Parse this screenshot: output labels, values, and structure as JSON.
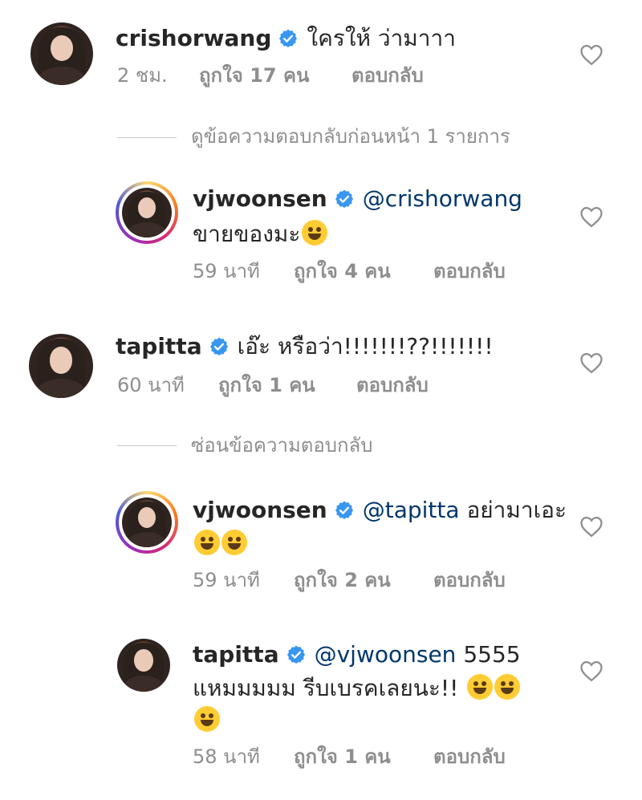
{
  "comments": [
    {
      "username": "crishorwang",
      "mention": "",
      "text": "ใครให้ ว่ามาาา",
      "text2": "",
      "time": "2 ชม.",
      "likes": "ถูกใจ 17 คน",
      "reply": "ตอบกลับ"
    },
    {
      "username": "vjwoonsen",
      "mention": "@crishorwang",
      "text": "",
      "text2": "ขายของมะ",
      "time": "59 นาที",
      "likes": "ถูกใจ 4 คน",
      "reply": "ตอบกลับ"
    },
    {
      "username": "tapitta",
      "mention": "",
      "text": "เอ๊ะ หรือว่า!!!!!!!??!!!!!!!",
      "text2": "",
      "time": "60 นาที",
      "likes": "ถูกใจ 1 คน",
      "reply": "ตอบกลับ"
    },
    {
      "username": "vjwoonsen",
      "mention": "@tapitta",
      "text": "อย่ามาเอะ",
      "text2": "",
      "time": "59 นาที",
      "likes": "ถูกใจ 2 คน",
      "reply": "ตอบกลับ"
    },
    {
      "username": "tapitta",
      "mention": "@vjwoonsen",
      "text": "5555",
      "text2": "แหมมมมม รีบเบรคเลยนะ!!",
      "time": "58 นาที",
      "likes": "ถูกใจ 1 คน",
      "reply": "ตอบกลับ"
    }
  ],
  "view_previous_replies": "ดูข้อความตอบกลับก่อนหน้า 1 รายการ",
  "hide_replies": "ซ่อนข้อความตอบกลับ",
  "colors": {
    "verified": "#3897f0",
    "mention": "#00376b",
    "meta": "#8e8e8e"
  },
  "icons": {
    "verified": "verified-badge-icon",
    "like": "heart-outline-icon",
    "emoji": "emoji-icon"
  }
}
